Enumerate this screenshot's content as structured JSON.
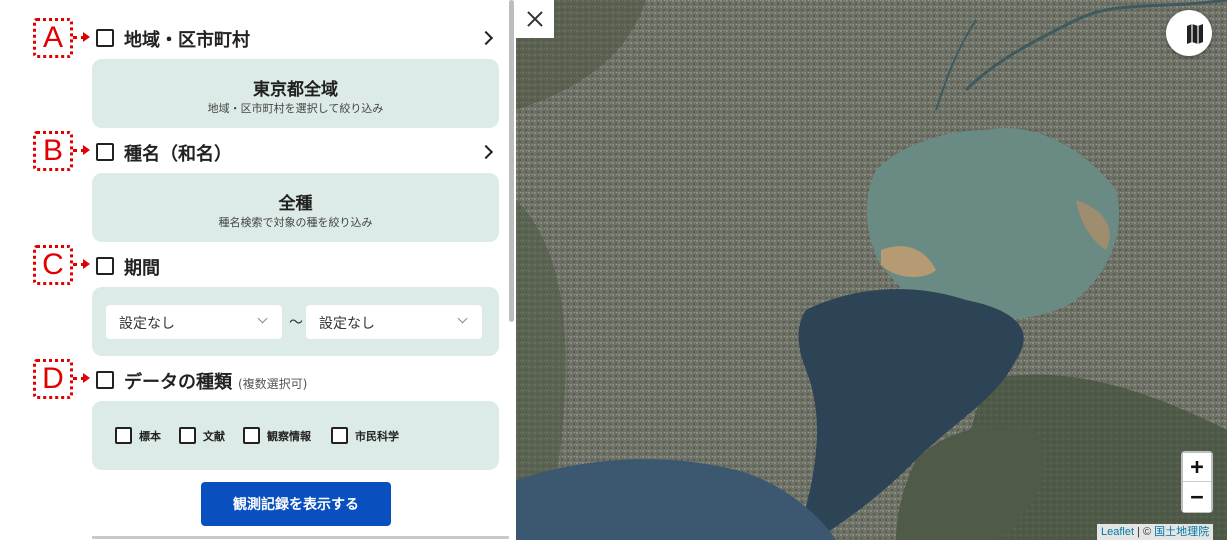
{
  "markers": [
    "A",
    "B",
    "C",
    "D"
  ],
  "sections": {
    "area": {
      "title": "地域・区市町村",
      "card_main": "東京都全域",
      "card_sub": "地域・区市町村を選択して絞り込み"
    },
    "species": {
      "title": "種名（和名）",
      "card_main": "全種",
      "card_sub": "種名検索で対象の種を絞り込み"
    },
    "period": {
      "title": "期間",
      "from_value": "設定なし",
      "separator": "〜",
      "to_value": "設定なし"
    },
    "data_type": {
      "title": "データの種類",
      "note": "(複数選択可)",
      "options": [
        "標本",
        "文献",
        "観察情報",
        "市民科学"
      ]
    }
  },
  "submit_label": "観測記録を表示する",
  "map": {
    "zoom_in": "+",
    "zoom_out": "−",
    "attribution_link": "Leaflet",
    "attribution_sep": " | © ",
    "attribution_source": "国土地理院",
    "close_icon": "close-icon",
    "layer_icon": "map-icon"
  },
  "colors": {
    "marker": "#e10000",
    "card_bg": "#dcebe7",
    "button_bg": "#0a4fbf"
  }
}
